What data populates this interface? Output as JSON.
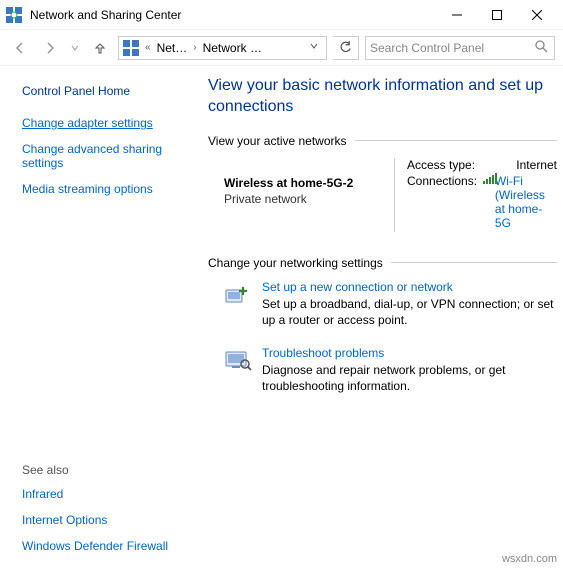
{
  "window": {
    "title": "Network and Sharing Center"
  },
  "toolbar": {
    "breadcrumb": {
      "seg1": "Net…",
      "seg2": "Network …"
    },
    "search_placeholder": "Search Control Panel"
  },
  "sidebar": {
    "home": "Control Panel Home",
    "links": [
      "Change adapter settings",
      "Change advanced sharing settings",
      "Media streaming options"
    ],
    "see_also_heading": "See also",
    "see_also": [
      "Infrared",
      "Internet Options",
      "Windows Defender Firewall"
    ]
  },
  "main": {
    "page_title": "View your basic network information and set up connections",
    "active_header": "View your active networks",
    "network": {
      "name": "Wireless at home-5G-2",
      "type": "Private network",
      "access_label": "Access type:",
      "access_value": "Internet",
      "conn_label": "Connections:",
      "conn_value": "Wi-Fi (Wireless at home-5G"
    },
    "settings_header": "Change your networking settings",
    "tasks": [
      {
        "title": "Set up a new connection or network",
        "desc": "Set up a broadband, dial-up, or VPN connection; or set up a router or access point."
      },
      {
        "title": "Troubleshoot problems",
        "desc": "Diagnose and repair network problems, or get troubleshooting information."
      }
    ]
  },
  "watermark": "wsxdn.com"
}
